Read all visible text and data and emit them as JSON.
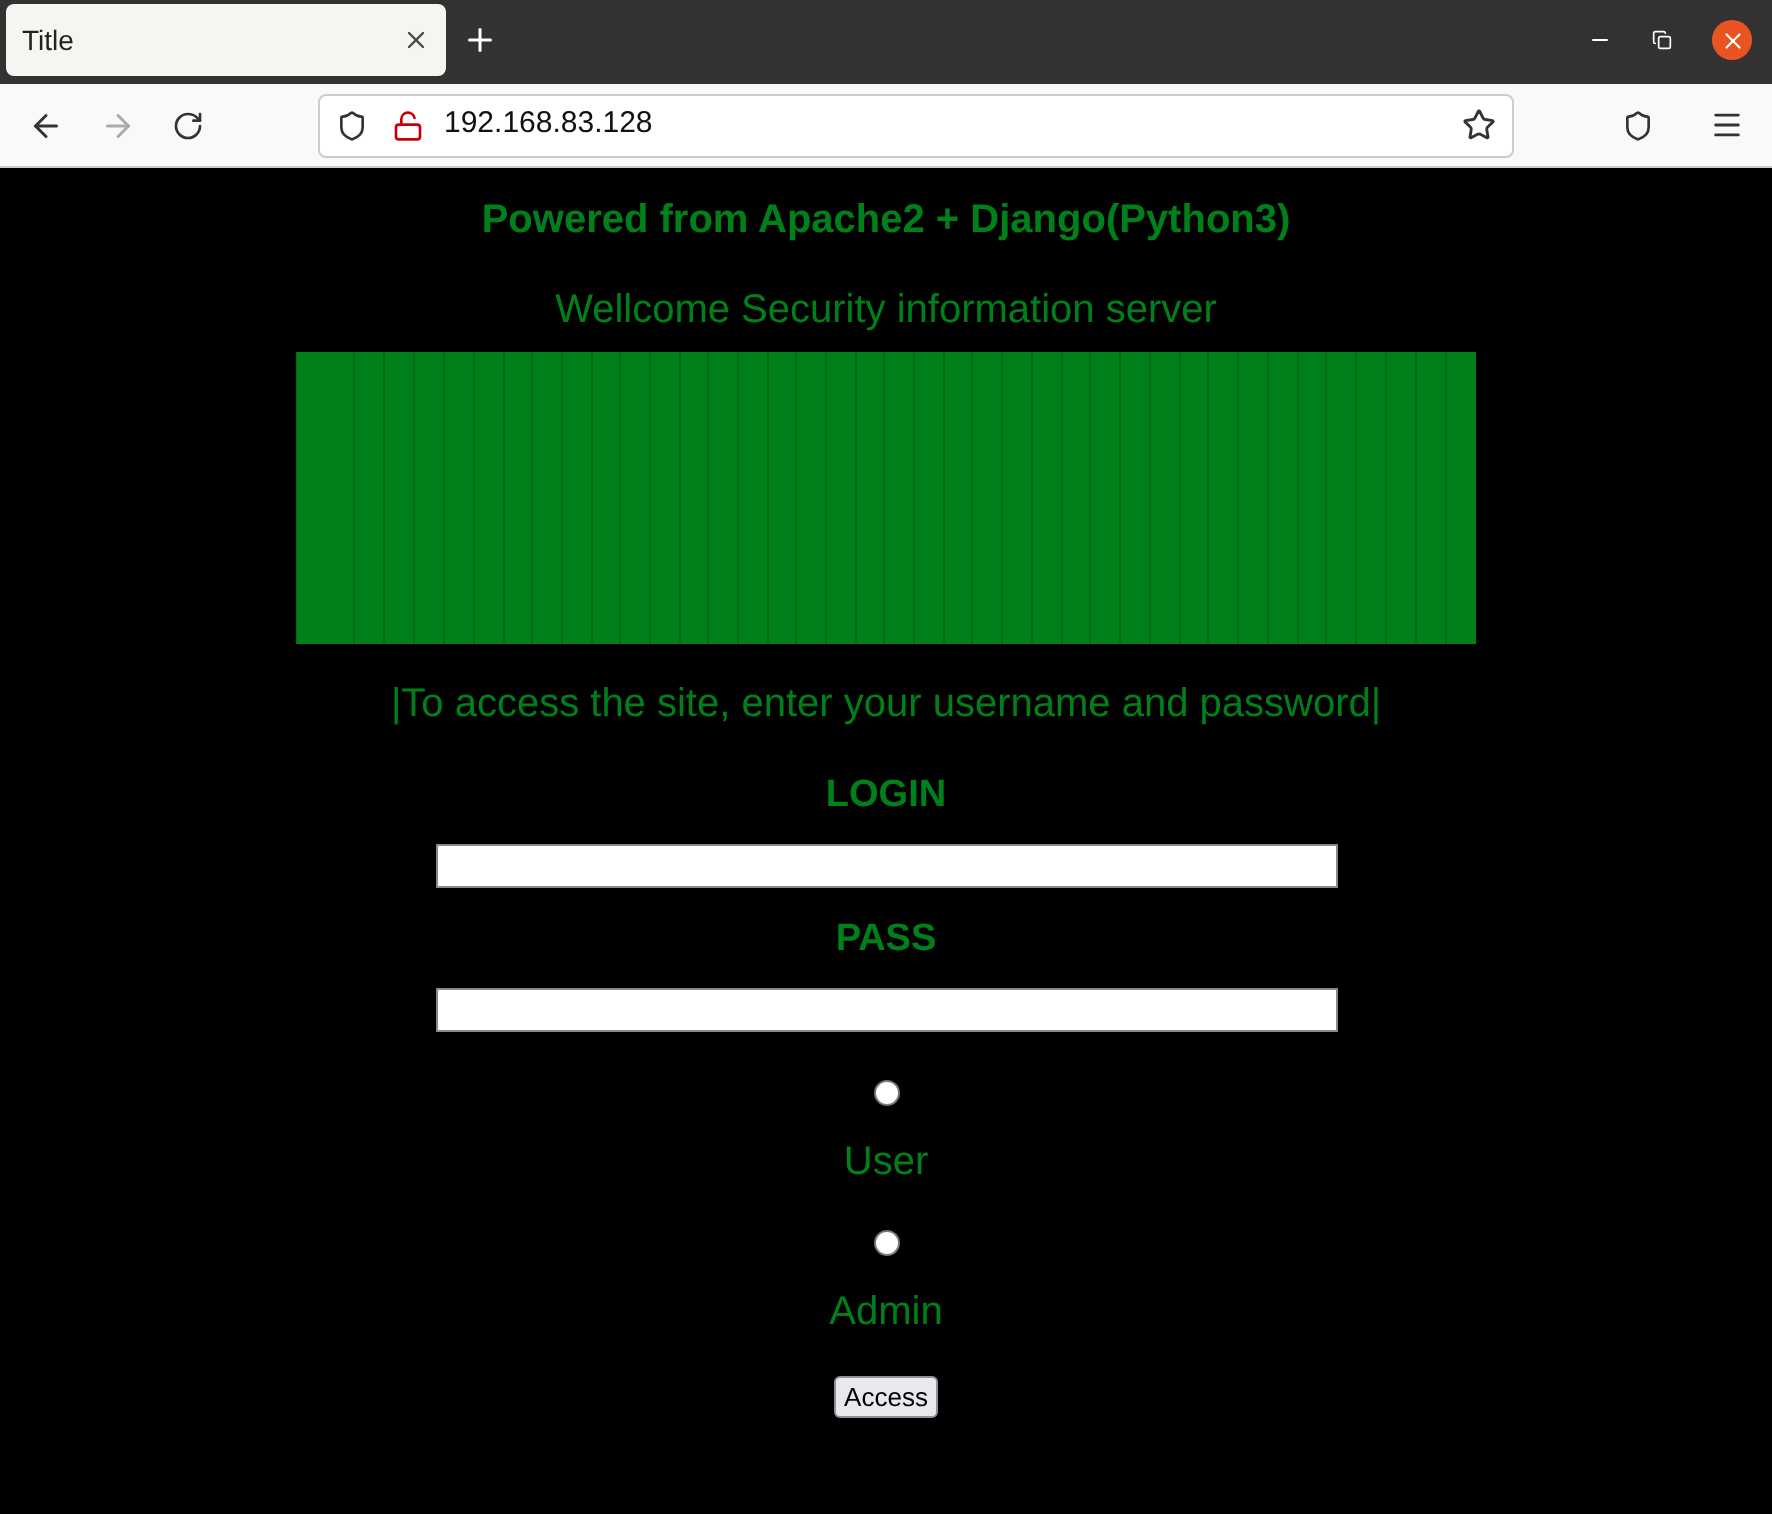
{
  "browser": {
    "tab_title": "Title",
    "address": "192.168.83.128"
  },
  "page": {
    "powered": "Powered from Apache2 + Django(Python3)",
    "welcome": "Wellcome Security information server",
    "instruction": "|To access the site, enter your username and password|",
    "fields": [
      {
        "label": "LOGIN"
      },
      {
        "label": "PASS"
      }
    ],
    "radios": [
      {
        "label": "User",
        "selected": false
      },
      {
        "label": "Admin",
        "selected": false
      }
    ],
    "button": "Access"
  }
}
